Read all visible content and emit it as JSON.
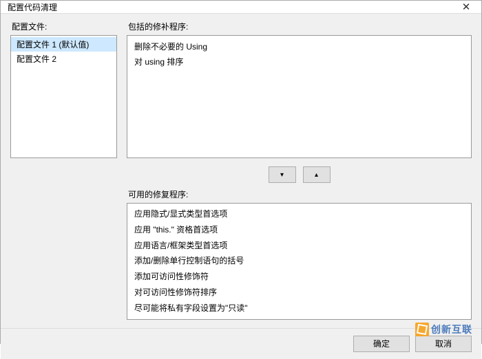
{
  "title": "配置代码清理",
  "labels": {
    "profiles": "配置文件:",
    "included": "包括的修补程序:",
    "available": "可用的修复程序:"
  },
  "profiles": {
    "items": [
      {
        "label": "配置文件 1 (默认值)",
        "selected": true
      },
      {
        "label": "配置文件 2",
        "selected": false
      }
    ]
  },
  "included_fixers": [
    "删除不必要的 Using",
    "对 using 排序"
  ],
  "available_fixers": [
    "应用隐式/显式类型首选项",
    "应用 \"this.\" 资格首选项",
    "应用语言/框架类型首选项",
    "添加/删除单行控制语句的括号",
    "添加可访问性修饰符",
    "对可访问性修饰符排序",
    "尽可能将私有字段设置为\"只读\""
  ],
  "buttons": {
    "ok": "确定",
    "cancel": "取消"
  },
  "icons": {
    "close": "✕",
    "down": "▾",
    "up": "▴"
  },
  "watermark": "创新互联"
}
